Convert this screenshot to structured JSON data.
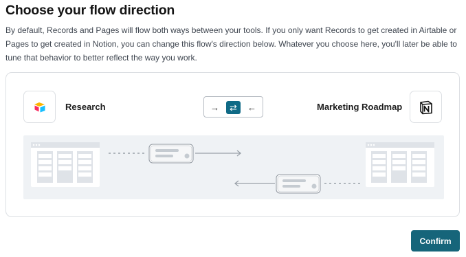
{
  "header": {
    "title": "Choose your flow direction",
    "description": "By default, Records and Pages will flow both ways between your tools. If you only want Records to get created in Airtable or Pages to get created in Notion, you can change this flow's direction below. Whatever you choose here, you'll later be able to tune that behavior to better reflect the way you work."
  },
  "left_app": {
    "name": "Research",
    "icon": "airtable-logo"
  },
  "right_app": {
    "name": "Marketing Roadmap",
    "icon": "notion-logo"
  },
  "direction_toggle": {
    "options": [
      {
        "symbol": "→",
        "icon": "arrow-right-icon",
        "selected": false
      },
      {
        "symbol": "⇄",
        "icon": "arrows-bidirectional-icon",
        "selected": true
      },
      {
        "symbol": "←",
        "icon": "arrow-left-icon",
        "selected": false
      }
    ]
  },
  "colors": {
    "accent": "#0f6a86",
    "button": "#16657a",
    "illustration_bg": "#eff2f5"
  },
  "footer": {
    "confirm_label": "Confirm"
  }
}
